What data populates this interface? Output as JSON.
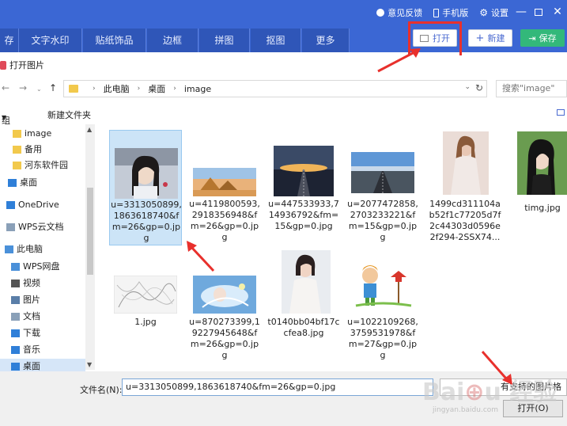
{
  "topbar": {
    "feedback_label": "意见反馈",
    "mobile_label": "手机版",
    "settings_label": "设置"
  },
  "tabs": [
    "存",
    "文字水印",
    "贴纸饰品",
    "边框",
    "拼图",
    "抠图",
    "更多"
  ],
  "toolbar": {
    "open_label": "打开",
    "new_label": "新建",
    "save_label": "保存"
  },
  "dialog": {
    "title": "打开图片",
    "breadcrumb": [
      "此电脑",
      "桌面",
      "image"
    ],
    "search_placeholder": "搜索\"image\"",
    "organize_label": "组织",
    "new_folder_label": "新建文件夹"
  },
  "nav_items": [
    {
      "label": "image",
      "icon": "folder-icon"
    },
    {
      "label": "备用",
      "icon": "folder-icon"
    },
    {
      "label": "河东软件园",
      "icon": "folder-icon"
    },
    {
      "label": "桌面",
      "icon": "desktop-icon"
    },
    {
      "label": "OneDrive",
      "icon": "cloud-icon"
    },
    {
      "label": "WPS云文档",
      "icon": "document-icon"
    },
    {
      "label": "此电脑",
      "icon": "computer-icon"
    },
    {
      "label": "WPS网盘",
      "icon": "cloud-drive-icon"
    },
    {
      "label": "视频",
      "icon": "video-icon"
    },
    {
      "label": "图片",
      "icon": "picture-icon"
    },
    {
      "label": "文档",
      "icon": "document-icon"
    },
    {
      "label": "下载",
      "icon": "download-icon"
    },
    {
      "label": "音乐",
      "icon": "music-icon"
    },
    {
      "label": "桌面",
      "icon": "desktop-icon"
    }
  ],
  "files": [
    {
      "name": "u=3313050899,1863618740&fm=26&gp=0.jpg",
      "selected": true
    },
    {
      "name": "u=4119800593,2918356948&fm=26&gp=0.jpg",
      "selected": false
    },
    {
      "name": "u=447533933,714936792&fm=15&gp=0.jpg",
      "selected": false
    },
    {
      "name": "u=2077472858,2703233221&fm=15&gp=0.jpg",
      "selected": false
    },
    {
      "name": "1499cd311104ab52f1c77205d7f2c44303d0596e2f294-2SSX74...",
      "selected": false
    },
    {
      "name": "timg.jpg",
      "selected": false
    },
    {
      "name": "1.jpg",
      "selected": false
    },
    {
      "name": "u=870273399,19227945648&fm=26&gp=0.jpg",
      "selected": false
    },
    {
      "name": "t0140bb04bf17ccfea8.jpg",
      "selected": false
    },
    {
      "name": "u=1022109268,3759531978&fm=27&gp=0.jpg",
      "selected": false
    }
  ],
  "bottom": {
    "filename_label": "文件名(N):",
    "filename_value": "u=3313050899,1863618740&fm=26&gp=0.jpg",
    "filter_value": "有支持的图片格",
    "open_button_label": "打开(O)"
  },
  "watermark": {
    "text": "Baidu 经验",
    "sub": "jingyan.baidu.com"
  },
  "colors": {
    "app_bar": "#3b67d4",
    "tab": "#2f56b8",
    "save": "#33b87a",
    "highlight": "#e8302c",
    "selection": "#cce4f7"
  }
}
